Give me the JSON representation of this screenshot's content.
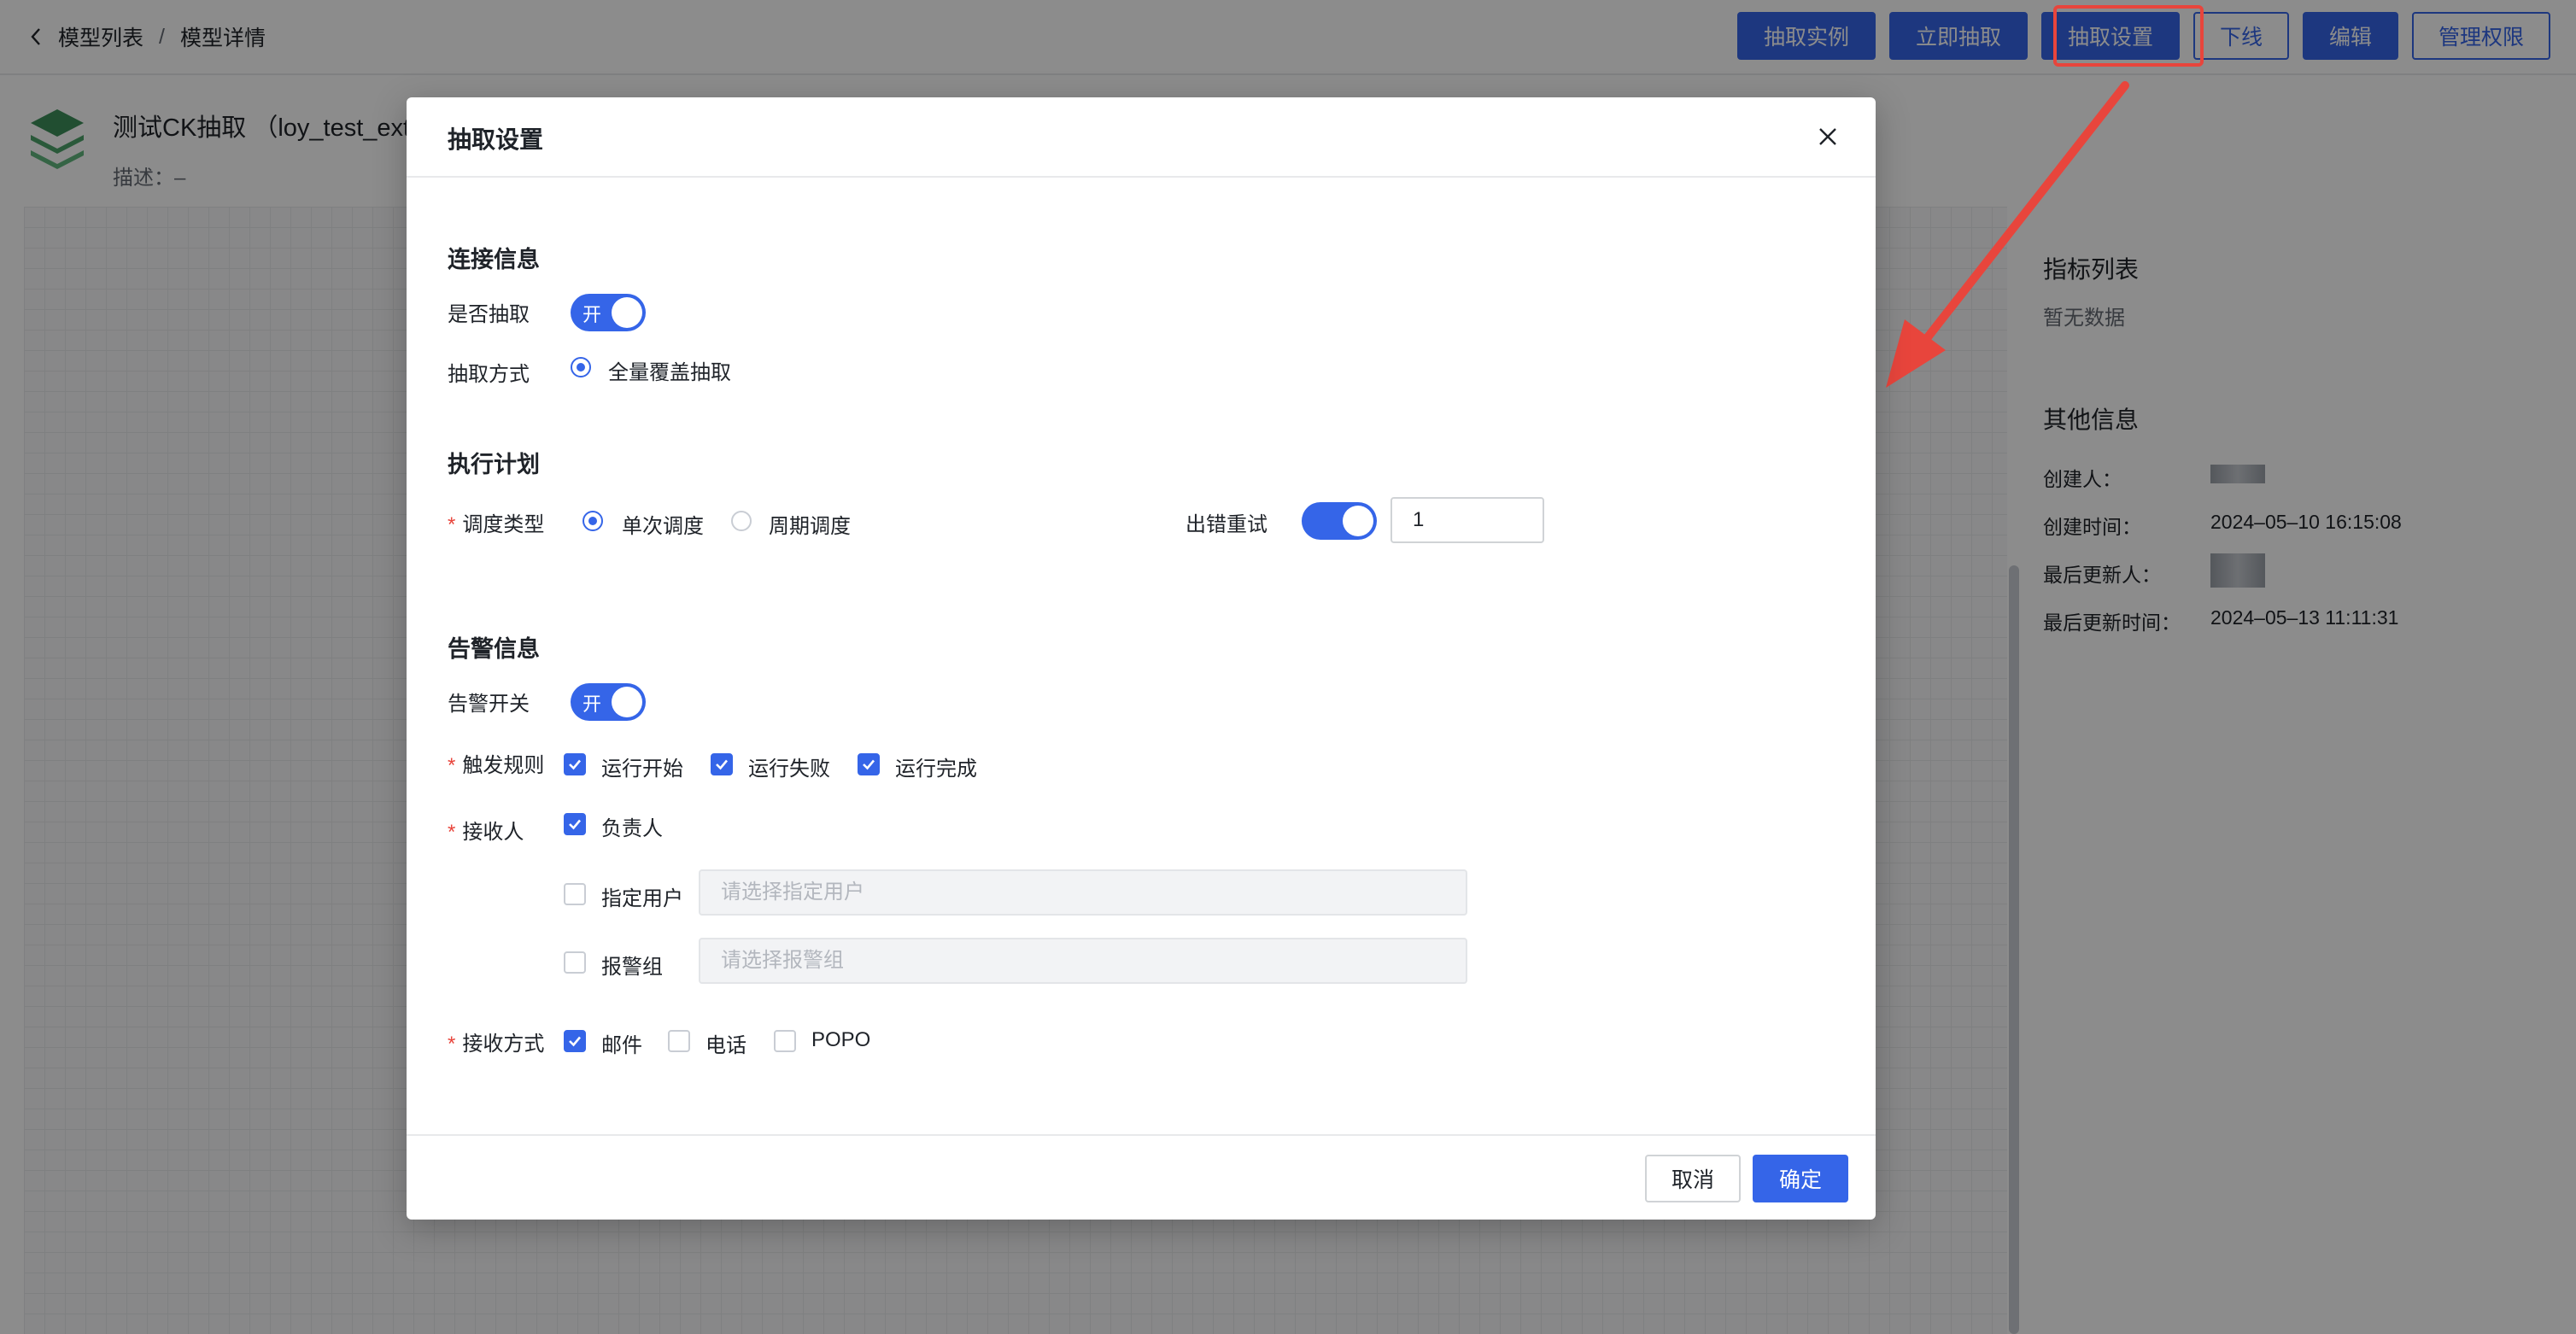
{
  "breadcrumb": {
    "items": [
      "模型列表",
      "模型详情"
    ],
    "separator": "/"
  },
  "header_actions": [
    "抽取实例",
    "立即抽取",
    "抽取设置",
    "下线",
    "编辑",
    "管理权限"
  ],
  "model": {
    "name": "测试CK抽取 （loy_test_ext",
    "desc": "描述：–"
  },
  "right_panel": {
    "metrics_title": "指标列表",
    "metrics_empty": "暂无数据",
    "other_title": "其他信息",
    "creator_label": "创建人：",
    "created_time_label": "创建时间：",
    "created_time": "2024–05–10 16:15:08",
    "updater_label": "最后更新人：",
    "updated_time_label": "最后更新时间：",
    "updated_time": "2024–05–13 11:11:31"
  },
  "modal": {
    "title": "抽取设置",
    "conn": {
      "title": "连接信息",
      "extract_label": "是否抽取",
      "extract_toggle": "开",
      "mode_label": "抽取方式",
      "mode_option": "全量覆盖抽取"
    },
    "plan": {
      "title": "执行计划",
      "schedule_label": "调度类型",
      "opt_once": "单次调度",
      "opt_cycle": "周期调度",
      "retry_label": "出错重试",
      "retry_value": "1"
    },
    "alert": {
      "title": "告警信息",
      "switch_label": "告警开关",
      "switch_toggle": "开",
      "trigger_label": "触发规则",
      "trigger_start": "运行开始",
      "trigger_fail": "运行失败",
      "trigger_done": "运行完成",
      "receiver_label": "接收人",
      "owner": "负责人",
      "specific_user": "指定用户",
      "specific_user_placeholder": "请选择指定用户",
      "alert_group": "报警组",
      "alert_group_placeholder": "请选择报警组",
      "method_label": "接收方式",
      "method_mail": "邮件",
      "method_phone": "电话",
      "method_popo": "POPO"
    },
    "cancel": "取消",
    "confirm": "确定"
  },
  "colors": {
    "primary": "#3565e8",
    "danger": "#e8453c",
    "annotation": "#e8453c"
  }
}
